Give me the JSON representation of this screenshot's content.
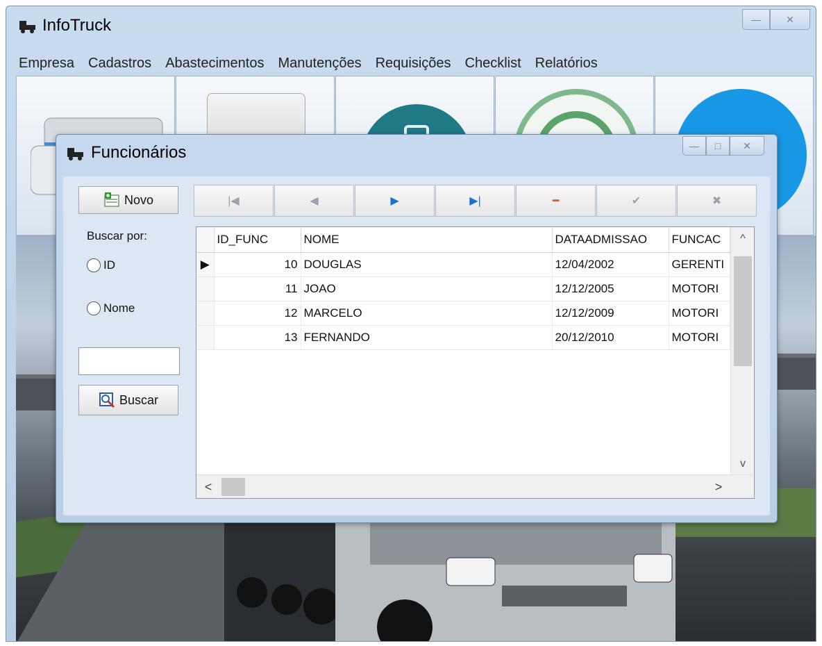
{
  "app": {
    "title": "InfoTruck",
    "window_controls": {
      "minimize": "—",
      "close": "✕"
    }
  },
  "menu": {
    "items": [
      "Empresa",
      "Cadastros",
      "Abastecimentos",
      "Manutenções",
      "Requisições",
      "Checklist",
      "Relatórios"
    ]
  },
  "ribbon": {
    "tiles": [
      "truck-tile-icon",
      "blank-tile-icon",
      "teal-circle-tile-icon",
      "green-circle-tile-icon",
      "blue-exit-tile-icon"
    ]
  },
  "dialog": {
    "title": "Funcionários",
    "window_controls": {
      "minimize": "—",
      "maximize": "□",
      "close": "✕"
    },
    "new_button": "Novo",
    "search_by_label": "Buscar por:",
    "radio_id": "ID",
    "radio_nome": "Nome",
    "search_value": "",
    "search_button": "Buscar",
    "navigator": {
      "first": "|◀",
      "prior": "◀",
      "next": "▶",
      "last": "▶|",
      "delete": "━",
      "post": "✔",
      "cancel": "✖"
    },
    "grid": {
      "columns": [
        "ID_FUNC",
        "NOME",
        "DATAADMISSAO",
        "FUNCAC"
      ],
      "rows": [
        {
          "indicator": "▶",
          "id": "10",
          "nome": "DOUGLAS",
          "data": "12/04/2002",
          "funcao": "GERENTI"
        },
        {
          "indicator": "",
          "id": "11",
          "nome": "JOAO",
          "data": "12/12/2005",
          "funcao": "MOTORI"
        },
        {
          "indicator": "",
          "id": "12",
          "nome": "MARCELO",
          "data": "12/12/2009",
          "funcao": "MOTORI"
        },
        {
          "indicator": "",
          "id": "13",
          "nome": "FERNANDO",
          "data": "20/12/2010",
          "funcao": "MOTORI"
        }
      ],
      "scroll": {
        "up": "^",
        "down": "v",
        "left": "<",
        "right": ">"
      }
    }
  },
  "colors": {
    "window_bg": "#c9dcef",
    "dialog_bg": "#dce7f3",
    "nav_active": "#1a73c8",
    "nav_delete": "#e0542b"
  }
}
